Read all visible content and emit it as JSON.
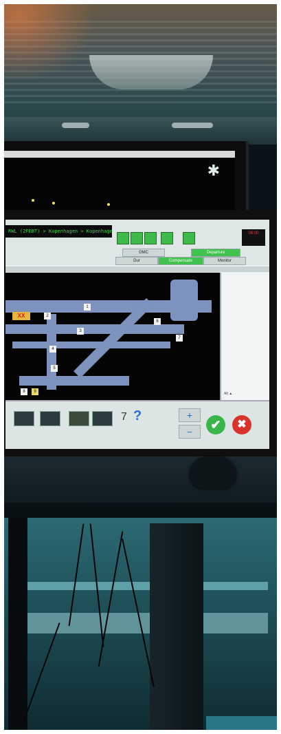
{
  "scene": {
    "main_monitor": {
      "status_text": "RWL (2FEBT) > Kopenhagen > Kopenhagen",
      "modes": [
        "GMC",
        "Departure",
        "Dur",
        "Compensate",
        "Monitor"
      ],
      "clock": "06:00"
    },
    "map": {
      "side_label": "Alt  ▲",
      "stand_labels": [
        "1",
        "2",
        "3",
        "4",
        "5",
        "6",
        "7",
        "8",
        "9"
      ],
      "marker": "XX"
    },
    "toolbar": {
      "plus": "+",
      "minus": "−",
      "ok_icon": "✔",
      "cancel_icon": "✖"
    }
  }
}
